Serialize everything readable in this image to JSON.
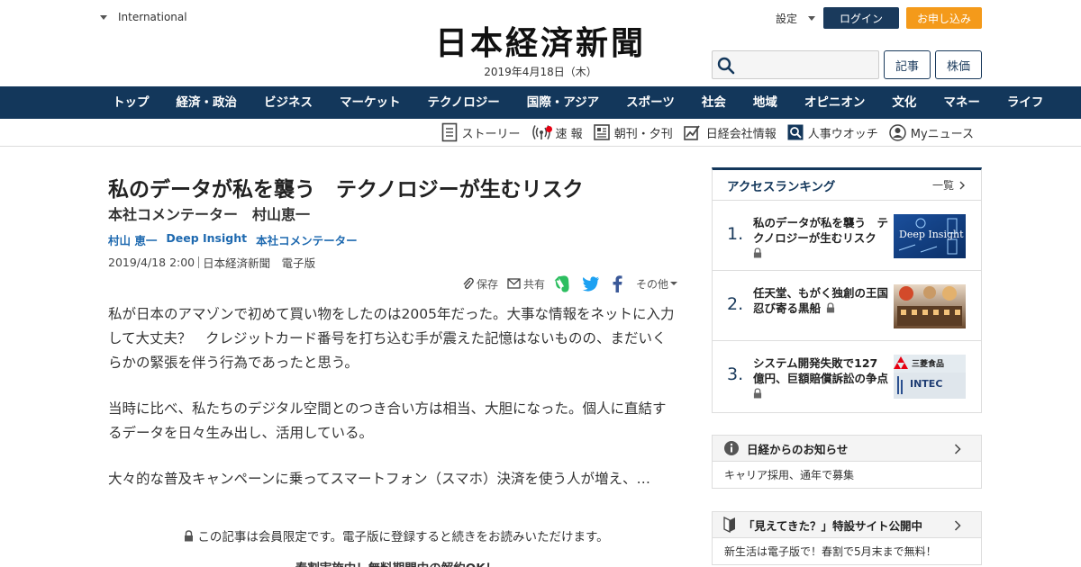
{
  "header": {
    "international_label": "International",
    "logo_text": "日本経済新聞",
    "date": "2019年4月18日（木）",
    "settings_label": "設定",
    "login_label": "ログイン",
    "apply_label": "お申し込み",
    "search_placeholder": "",
    "article_button": "記事",
    "stock_button": "株価"
  },
  "nav": {
    "items": [
      "トップ",
      "経済・政治",
      "ビジネス",
      "マーケット",
      "テクノロジー",
      "国際・アジア",
      "スポーツ",
      "社会",
      "地域",
      "オピニオン",
      "文化",
      "マネー",
      "ライフ"
    ]
  },
  "subnav": {
    "items": [
      "ストーリー",
      "速 報",
      "朝刊・夕刊",
      "日経会社情報",
      "人事ウオッチ",
      "Myニュース"
    ]
  },
  "article": {
    "title": "私のデータが私を襲う　テクノロジーが生むリスク",
    "subtitle": "本社コメンテーター　村山恵一",
    "tags": [
      "村山 恵一",
      "Deep Insight",
      "本社コメンテーター"
    ],
    "datetime": "2019/4/18 2:00",
    "source": "日本経済新聞　電子版",
    "share": {
      "save": "保存",
      "share": "共有",
      "other": "その他"
    },
    "paragraphs": [
      "私が日本のアマゾンで初めて買い物をしたのは2005年だった。大事な情報をネットに入力して大丈夫？　クレジットカード番号を打ち込む手が震えた記憶はないものの、まだいくらかの緊張を伴う行為であったと思う。",
      "当時に比べ、私たちのデジタル空間とのつき合い方は相当、大胆になった。個人に直結するデータを日々生み出し、活用している。",
      "大々的な普及キャンペーンに乗ってスマートフォン（スマホ）決済を使う人が増え、…"
    ],
    "members_notice": "この記事は会員限定です。電子版に登録すると続きをお読みいただけます。",
    "promo": "春割実施中！無料期間中の解約OK！"
  },
  "ranking": {
    "title": "アクセスランキング",
    "more": "一覧",
    "items": [
      {
        "rank": "1.",
        "title": "私のデータが私を襲う　テクノロジーが生むリスク",
        "thumb_text": "Deep Insight"
      },
      {
        "rank": "2.",
        "title": "任天堂、もがく独創の王国　忍び寄る黒船",
        "thumb_text": ""
      },
      {
        "rank": "3.",
        "title": "システム開発失敗で127億円、巨額賠償訴訟の争点",
        "thumb_text": "INTEC"
      }
    ],
    "thumb3_label": "三菱食品"
  },
  "notices": [
    {
      "title": "日経からのお知らせ",
      "body": "キャリア採用、通年で募集"
    },
    {
      "title": "「見えてきた？」特設サイト公開中",
      "body": "新生活は電子版で！春割で5月末まで無料！"
    }
  ],
  "colors": {
    "navy": "#13375b",
    "orange": "#f49a1a",
    "link_blue": "#1f6ab0",
    "evernote_green": "#2dbe60",
    "twitter_blue": "#1da1f2",
    "facebook_blue": "#3b5998"
  }
}
